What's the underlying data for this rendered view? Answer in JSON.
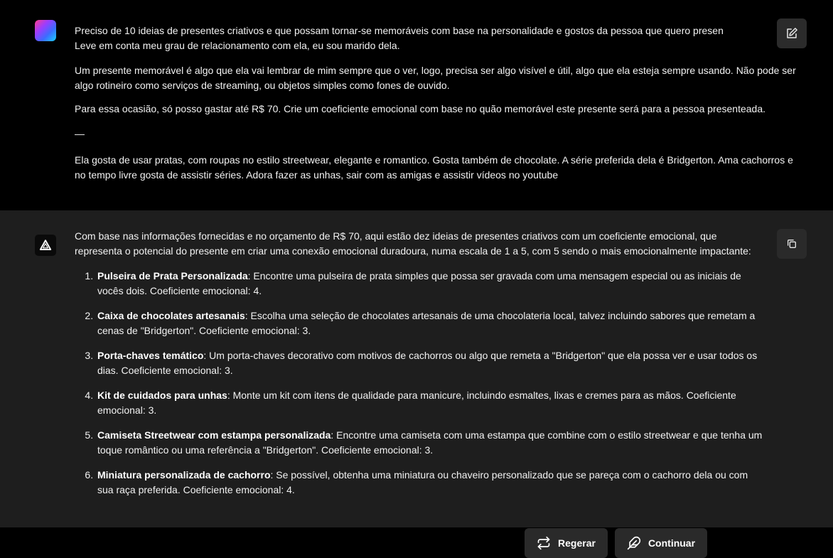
{
  "user": {
    "paragraph1_line1": "Preciso de 10 ideias de presentes criativos e que possam tornar-se memoráveis com base na personalidade e gostos da pessoa que quero presen",
    "paragraph1_line2": "Leve em conta meu grau de relacionamento com ela, eu sou marido dela.",
    "paragraph2": "Um presente memorável é algo que ela vai lembrar de mim sempre que o ver, logo, precisa ser algo visível e útil, algo que ela esteja sempre usando. Não pode ser algo rotineiro como serviços de streaming, ou objetos simples como fones de ouvido.",
    "paragraph3": "Para essa ocasião, só posso gastar até R$ 70. Crie um coeficiente emocional com base no quão memorável este presente será para a pessoa presenteada.",
    "separator": "—",
    "paragraph4": "Ela gosta de usar pratas, com roupas no estilo streetwear, elegante e romantico. Gosta também de chocolate. A série preferida dela é Bridgerton. Ama cachorros e no tempo livre gosta de assistir séries. Adora fazer as unhas, sair com as amigas e assistir vídeos no youtube"
  },
  "assistant": {
    "intro": "Com base nas informações fornecidas e no orçamento de R$ 70, aqui estão dez ideias de presentes criativos com um coeficiente emocional, que representa o potencial do presente em criar uma conexão emocional duradoura, numa escala de 1 a 5, com 5 sendo o mais emocionalmente impactante:",
    "ideas": [
      {
        "title": "Pulseira de Prata Personalizada",
        "text": ": Encontre uma pulseira de prata simples que possa ser gravada com uma mensagem especial ou as iniciais de vocês dois. Coeficiente emocional: 4."
      },
      {
        "title": "Caixa de chocolates artesanais",
        "text": ": Escolha uma seleção de chocolates artesanais de uma chocolateria local, talvez incluindo sabores que remetam a cenas de \"Bridgerton\". Coeficiente emocional: 3."
      },
      {
        "title": "Porta-chaves temático",
        "text": ": Um porta-chaves decorativo com motivos de cachorros ou algo que remeta a \"Bridgerton\" que ela possa ver e usar todos os dias. Coeficiente emocional: 3."
      },
      {
        "title": "Kit de cuidados para unhas",
        "text": ": Monte um kit com itens de qualidade para manicure, incluindo esmaltes, lixas e cremes para as mãos. Coeficiente emocional: 3."
      },
      {
        "title": "Camiseta Streetwear com estampa personalizada",
        "text": ": Encontre uma camiseta com uma estampa que combine com o estilo streetwear e que tenha um toque romântico ou uma referência a \"Bridgerton\". Coeficiente emocional: 3."
      },
      {
        "title": "Miniatura personalizada de cachorro",
        "text": ": Se possível, obtenha uma miniatura ou chaveiro personalizado que se pareça com o cachorro dela ou com sua raça preferida. Coeficiente emocional: 4."
      }
    ]
  },
  "actions": {
    "regenerate_label": "Regerar",
    "continue_label": "Continuar"
  },
  "icons": {
    "edit": "edit-icon",
    "copy": "copy-icon",
    "regenerate": "regenerate-icon",
    "continue": "feather-icon",
    "assistant_logo": "triangle-logo-icon"
  },
  "colors": {
    "background": "#000000",
    "assistant_background": "#1e1e1e",
    "button_background": "#2a2a2a",
    "text": "#f2f2f2"
  }
}
